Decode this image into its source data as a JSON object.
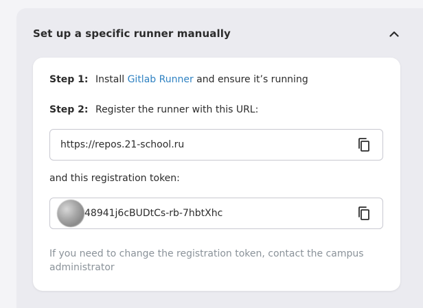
{
  "section": {
    "title": "Set up a specific runner manually",
    "toggle_icon": "chevron-up-icon"
  },
  "step1": {
    "label": "Step 1:",
    "text_before": "Install",
    "link_text": "Gitlab Runner",
    "text_after": "and ensure it’s running"
  },
  "step2": {
    "label": "Step 2:",
    "text": "Register the runner with this URL:"
  },
  "url_field": {
    "value": "https://repos.21-school.ru",
    "copy_icon": "copy-icon"
  },
  "token_label": "and this registration token:",
  "token_field": {
    "value": "48941j6cBUDtCs-rb-7hbtXhc",
    "copy_icon": "copy-icon"
  },
  "note": "If you need to change the registration token, contact the campus administrator",
  "colors": {
    "link": "#2f82c2",
    "muted_text": "#8a9299",
    "page_bg": "#f4f4f7",
    "panel_bg": "#ebebf0"
  }
}
